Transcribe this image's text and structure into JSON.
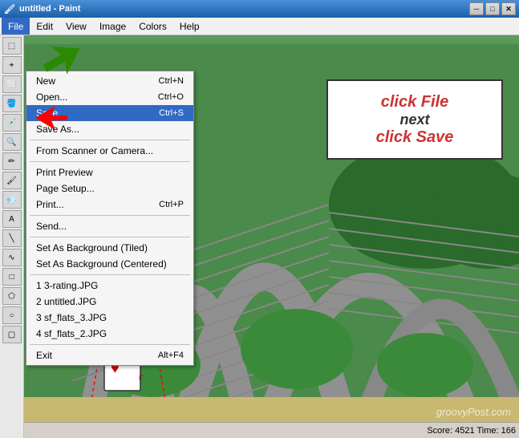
{
  "titleBar": {
    "title": "untitled - Paint",
    "icon": "🎨",
    "minimizeLabel": "─",
    "maximizeLabel": "□",
    "closeLabel": "✕"
  },
  "menuBar": {
    "items": [
      {
        "id": "file",
        "label": "File",
        "active": true
      },
      {
        "id": "edit",
        "label": "Edit"
      },
      {
        "id": "view",
        "label": "View"
      },
      {
        "id": "image",
        "label": "Image"
      },
      {
        "id": "colors",
        "label": "Colors"
      },
      {
        "id": "help",
        "label": "Help"
      }
    ]
  },
  "fileMenu": {
    "items": [
      {
        "id": "new",
        "label": "New",
        "shortcut": "Ctrl+N",
        "separator": false
      },
      {
        "id": "open",
        "label": "Open...",
        "shortcut": "Ctrl+O",
        "separator": false
      },
      {
        "id": "save",
        "label": "Save",
        "shortcut": "Ctrl+S",
        "selected": true,
        "separator": false
      },
      {
        "id": "saveas",
        "label": "Save As...",
        "shortcut": "",
        "separator": true
      },
      {
        "id": "scanner",
        "label": "From Scanner or Camera...",
        "shortcut": "",
        "separator": true
      },
      {
        "id": "printpreview",
        "label": "Print Preview",
        "shortcut": "",
        "separator": false
      },
      {
        "id": "pagesetup",
        "label": "Page Setup...",
        "shortcut": "",
        "separator": false
      },
      {
        "id": "print",
        "label": "Print...",
        "shortcut": "Ctrl+P",
        "separator": true
      },
      {
        "id": "send",
        "label": "Send...",
        "shortcut": "",
        "separator": true
      },
      {
        "id": "setbg1",
        "label": "Set As Background (Tiled)",
        "shortcut": "",
        "separator": false
      },
      {
        "id": "setbg2",
        "label": "Set As Background (Centered)",
        "shortcut": "",
        "separator": true
      },
      {
        "id": "recent1",
        "label": "1 3-rating.JPG",
        "shortcut": "",
        "separator": false
      },
      {
        "id": "recent2",
        "label": "2 untitled.JPG",
        "shortcut": "",
        "separator": false
      },
      {
        "id": "recent3",
        "label": "3 sf_flats_3.JPG",
        "shortcut": "",
        "separator": false
      },
      {
        "id": "recent4",
        "label": "4 sf_flats_2.JPG",
        "shortcut": "",
        "separator": true
      },
      {
        "id": "exit",
        "label": "Exit",
        "shortcut": "Alt+F4",
        "separator": false
      }
    ]
  },
  "instructionBox": {
    "line1": "click File",
    "line2": "next",
    "line3": "click Save"
  },
  "statusBar": {
    "text": "Score: 4521  Time: 166"
  },
  "watermark": {
    "text": "groovyPost.com"
  }
}
